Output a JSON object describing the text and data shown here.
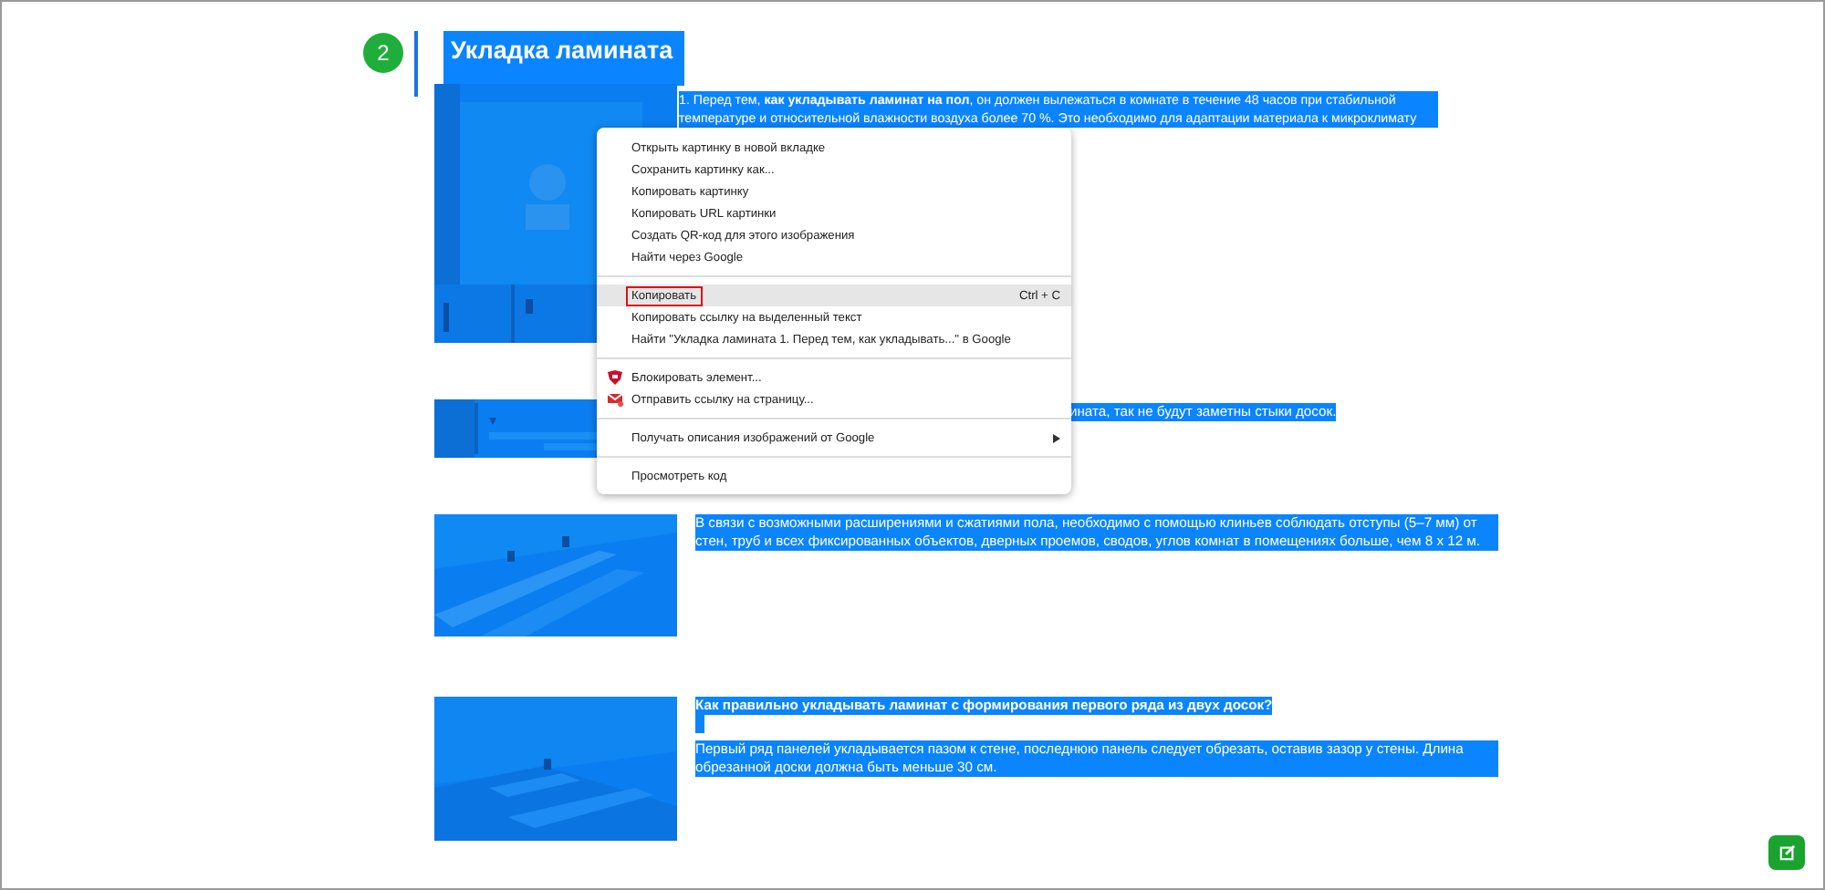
{
  "section": {
    "number": "2",
    "title": "Укладка ламината"
  },
  "blocks": [
    {
      "paragraphs": [
        "1. Перед тем, **как укладывать ламинат на пол**, он должен вылежаться в комнате в течение 48 часов при стабильной температуре и относительной влажности воздуха более 70 %. Это необходимо для адаптации материала к микроклимату"
      ]
    },
    {
      "paragraphs": [
        "ината, так не будут заметны стыки досок."
      ]
    },
    {
      "paragraphs": [
        "В связи с возможными расширениями и сжатиями пола, необходимо с помощью клиньев соблюдать отступы (5–7 мм) от стен, труб и всех фиксированных объектов, дверных проемов, сводов, углов комнат в помещениях больше, чем 8 х 12 м."
      ]
    },
    {
      "paragraphs": [
        "**Как правильно укладывать ламинат с формирования первого ряда из двух досок?**",
        "Первый ряд панелей укладывается пазом к стене, последнюю панель следует обрезать, оставив зазор у стены. Длина обрезанной доски должна быть меньше 30 см."
      ]
    }
  ],
  "context_menu": {
    "items": [
      {
        "kind": "item",
        "label": "Открыть картинку в новой вкладке",
        "selected": false
      },
      {
        "kind": "item",
        "label": "Сохранить картинку как...",
        "selected": false
      },
      {
        "kind": "item",
        "label": "Копировать картинку",
        "selected": false
      },
      {
        "kind": "item",
        "label": "Копировать URL картинки",
        "selected": false
      },
      {
        "kind": "item",
        "label": "Создать QR-код для этого изображения",
        "selected": false
      },
      {
        "kind": "item",
        "label": "Найти через Google",
        "selected": false
      },
      {
        "kind": "separator"
      },
      {
        "kind": "item",
        "label": "Копировать",
        "shortcut": "Ctrl + C",
        "selected": true
      },
      {
        "kind": "item",
        "label": "Копировать ссылку на выделенный текст",
        "selected": false
      },
      {
        "kind": "item",
        "label": "Найти \"Укладка ламината  1. Перед тем, как укладывать...\" в Google",
        "selected": false
      },
      {
        "kind": "separator"
      },
      {
        "kind": "shield_item",
        "label": "Блокировать элемент...",
        "selected": false
      },
      {
        "kind": "mail_item",
        "label": "Отправить ссылку на страницу...",
        "selected": false
      },
      {
        "kind": "separator"
      },
      {
        "kind": "submenu_item",
        "label": "Получать описания изображений от Google",
        "selected": false
      },
      {
        "kind": "separator"
      },
      {
        "kind": "item",
        "label": "Просмотреть код",
        "selected": false
      }
    ]
  }
}
